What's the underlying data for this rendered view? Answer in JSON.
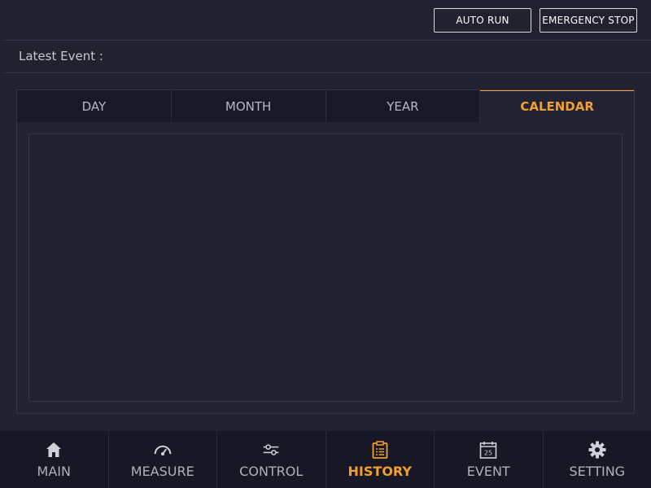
{
  "topbar": {
    "auto_run_label": "AUTO RUN",
    "emergency_stop_label": "EMERGENCY STOP"
  },
  "event": {
    "label": "Latest Event :",
    "value": ""
  },
  "tabs": [
    {
      "label": "DAY",
      "active": false
    },
    {
      "label": "MONTH",
      "active": false
    },
    {
      "label": "YEAR",
      "active": false
    },
    {
      "label": "CALENDAR",
      "active": true
    }
  ],
  "nav": [
    {
      "label": "MAIN",
      "icon": "home-icon",
      "active": false
    },
    {
      "label": "MEASURE",
      "icon": "gauge-icon",
      "active": false
    },
    {
      "label": "CONTROL",
      "icon": "sliders-icon",
      "active": false
    },
    {
      "label": "HISTORY",
      "icon": "clipboard-list-icon",
      "active": true
    },
    {
      "label": "EVENT",
      "icon": "calendar-icon",
      "active": false
    },
    {
      "label": "SETTING",
      "icon": "gear-icon",
      "active": false
    }
  ],
  "calendar_icon_day": "25",
  "colors": {
    "background": "#21212f",
    "accent": "#f0a030",
    "tab_inactive": "#181828",
    "nav_background": "#171726"
  }
}
